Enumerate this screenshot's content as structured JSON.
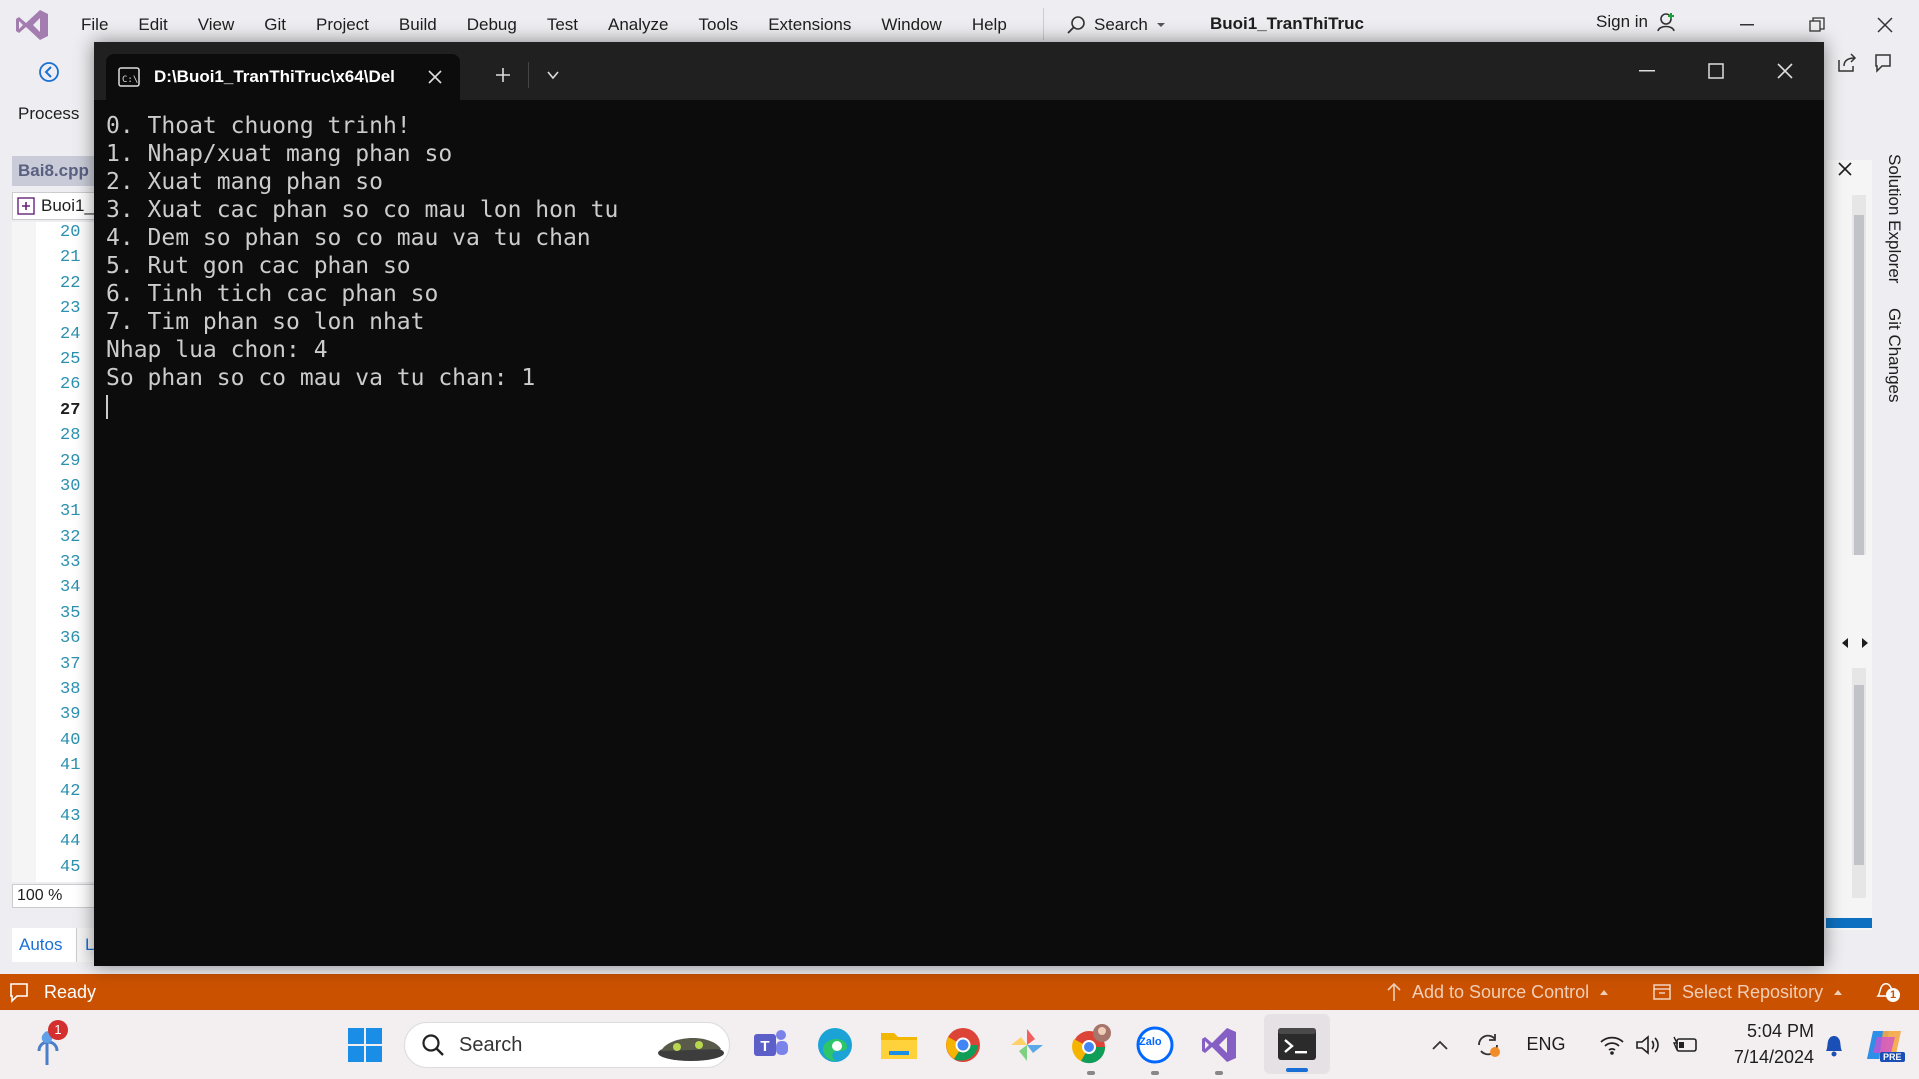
{
  "vs": {
    "menu": [
      "File",
      "Edit",
      "View",
      "Git",
      "Project",
      "Build",
      "Debug",
      "Test",
      "Analyze",
      "Tools",
      "Extensions",
      "Window",
      "Help"
    ],
    "search_label": "Search",
    "solution_name": "Buoi1_TranThiTruc",
    "sign_in": "Sign in",
    "process_label": "Process",
    "doc_tab": "Bai8.cpp",
    "scope": "Buoi1_",
    "line_numbers": [
      "20",
      "21",
      "22",
      "23",
      "24",
      "25",
      "26",
      "27",
      "28",
      "29",
      "30",
      "31",
      "32",
      "33",
      "34",
      "35",
      "36",
      "37",
      "38",
      "39",
      "40",
      "41",
      "42",
      "43",
      "44",
      "45"
    ],
    "current_line": "27",
    "zoom": "100 %",
    "autos_tab": "Autos",
    "autos_tab2": "L",
    "side_tabs": [
      "Solution Explorer",
      "Git Changes"
    ],
    "status": {
      "ready": "Ready",
      "add_source": "Add to Source Control",
      "select_repo": "Select Repository",
      "notifications": "1"
    },
    "colors": {
      "status_bar": "#ca5100",
      "accent": "#0e70c0"
    }
  },
  "terminal": {
    "tab_title": "D:\\Buoi1_TranThiTruc\\x64\\Del",
    "lines": [
      "0. Thoat chuong trinh!",
      "1. Nhap/xuat mang phan so",
      "2. Xuat mang phan so",
      "3. Xuat cac phan so co mau lon hon tu",
      "4. Dem so phan so co mau va tu chan",
      "5. Rut gon cac phan so",
      "6. Tinh tich cac phan so",
      "7. Tim phan so lon nhat",
      "Nhap lua chon: 4",
      "So phan so co mau va tu chan: 1"
    ]
  },
  "taskbar": {
    "search_placeholder": "Search",
    "weather_badge": "1",
    "apps": [
      "start-icon",
      "teams-icon",
      "edge-icon",
      "file-explorer-icon",
      "chrome-icon",
      "pinwheel-app-icon",
      "chrome-profile-icon",
      "zalo-icon",
      "visual-studio-icon",
      "terminal-icon"
    ],
    "zalo_label": "Zalo",
    "language": "ENG",
    "time": "5:04 PM",
    "date": "7/14/2024",
    "copilot_badge": "PRE"
  }
}
